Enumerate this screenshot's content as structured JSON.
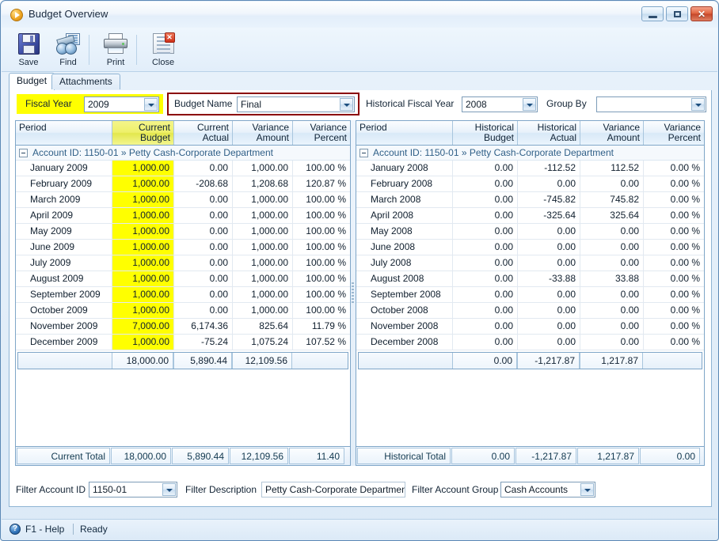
{
  "window": {
    "title": "Budget Overview",
    "icon": "play-circle-icon",
    "buttons": {
      "minimize": "minimize-button",
      "maximize": "maximize-button",
      "close": "✕"
    }
  },
  "toolbar": {
    "items": [
      {
        "label": "Save",
        "icon": "floppy-disk-icon"
      },
      {
        "label": "Find",
        "icon": "binoculars-icon"
      },
      {
        "label": "Print",
        "icon": "printer-icon"
      },
      {
        "label": "Close",
        "icon": "close-document-icon"
      }
    ]
  },
  "tabs": [
    {
      "label": "Budget",
      "active": true
    },
    {
      "label": "Attachments",
      "active": false
    }
  ],
  "criteria": {
    "fiscal_year_label": "Fiscal Year",
    "fiscal_year_value": "2009",
    "budget_name_label": "Budget Name",
    "budget_name_value": "Final",
    "historical_fiscal_year_label": "Historical Fiscal Year",
    "historical_fiscal_year_value": "2008",
    "group_by_label": "Group By",
    "group_by_value": "",
    "highlight_yellow": "#ffff00",
    "highlight_red_border": "#8b0000"
  },
  "left_grid": {
    "headers": [
      "Period",
      "Current\nBudget",
      "Current\nActual",
      "Variance\nAmount",
      "Variance\nPercent"
    ],
    "header_lines": [
      [
        "Period",
        ""
      ],
      [
        "Current",
        "Budget"
      ],
      [
        "Current",
        "Actual"
      ],
      [
        "Variance",
        "Amount"
      ],
      [
        "Variance",
        "Percent"
      ]
    ],
    "group_row": {
      "prefix": "Account ID: 1150-01",
      "separator": "»",
      "description": "Petty Cash-Corporate Department"
    },
    "rows": [
      {
        "period": "January 2009",
        "budget": "1,000.00",
        "actual": "0.00",
        "variance_amount": "1,000.00",
        "variance_percent": "100.00 %"
      },
      {
        "period": "February 2009",
        "budget": "1,000.00",
        "actual": "-208.68",
        "variance_amount": "1,208.68",
        "variance_percent": "120.87 %"
      },
      {
        "period": "March 2009",
        "budget": "1,000.00",
        "actual": "0.00",
        "variance_amount": "1,000.00",
        "variance_percent": "100.00 %"
      },
      {
        "period": "April 2009",
        "budget": "1,000.00",
        "actual": "0.00",
        "variance_amount": "1,000.00",
        "variance_percent": "100.00 %"
      },
      {
        "period": "May 2009",
        "budget": "1,000.00",
        "actual": "0.00",
        "variance_amount": "1,000.00",
        "variance_percent": "100.00 %"
      },
      {
        "period": "June 2009",
        "budget": "1,000.00",
        "actual": "0.00",
        "variance_amount": "1,000.00",
        "variance_percent": "100.00 %"
      },
      {
        "period": "July 2009",
        "budget": "1,000.00",
        "actual": "0.00",
        "variance_amount": "1,000.00",
        "variance_percent": "100.00 %"
      },
      {
        "period": "August 2009",
        "budget": "1,000.00",
        "actual": "0.00",
        "variance_amount": "1,000.00",
        "variance_percent": "100.00 %"
      },
      {
        "period": "September 2009",
        "budget": "1,000.00",
        "actual": "0.00",
        "variance_amount": "1,000.00",
        "variance_percent": "100.00 %"
      },
      {
        "period": "October 2009",
        "budget": "1,000.00",
        "actual": "0.00",
        "variance_amount": "1,000.00",
        "variance_percent": "100.00 %"
      },
      {
        "period": "November 2009",
        "budget": "7,000.00",
        "actual": "6,174.36",
        "variance_amount": "825.64",
        "variance_percent": "11.79 %"
      },
      {
        "period": "December 2009",
        "budget": "1,000.00",
        "actual": "-75.24",
        "variance_amount": "1,075.24",
        "variance_percent": "107.52 %"
      }
    ],
    "subtotal": {
      "budget": "18,000.00",
      "actual": "5,890.44",
      "variance_amount": "12,109.56",
      "variance_percent": ""
    },
    "total": {
      "label": "Current Total",
      "budget": "18,000.00",
      "actual": "5,890.44",
      "variance_amount": "12,109.56",
      "variance_percent": "11.40"
    }
  },
  "right_grid": {
    "header_lines": [
      [
        "Period",
        ""
      ],
      [
        "Historical",
        "Budget"
      ],
      [
        "Historical",
        "Actual"
      ],
      [
        "Variance",
        "Amount"
      ],
      [
        "Variance",
        "Percent"
      ]
    ],
    "group_row": {
      "prefix": "Account ID: 1150-01",
      "separator": "»",
      "description": "Petty Cash-Corporate Department"
    },
    "rows": [
      {
        "period": "January 2008",
        "budget": "0.00",
        "actual": "-112.52",
        "variance_amount": "112.52",
        "variance_percent": "0.00 %"
      },
      {
        "period": "February 2008",
        "budget": "0.00",
        "actual": "0.00",
        "variance_amount": "0.00",
        "variance_percent": "0.00 %"
      },
      {
        "period": "March 2008",
        "budget": "0.00",
        "actual": "-745.82",
        "variance_amount": "745.82",
        "variance_percent": "0.00 %"
      },
      {
        "period": "April 2008",
        "budget": "0.00",
        "actual": "-325.64",
        "variance_amount": "325.64",
        "variance_percent": "0.00 %"
      },
      {
        "period": "May 2008",
        "budget": "0.00",
        "actual": "0.00",
        "variance_amount": "0.00",
        "variance_percent": "0.00 %"
      },
      {
        "period": "June 2008",
        "budget": "0.00",
        "actual": "0.00",
        "variance_amount": "0.00",
        "variance_percent": "0.00 %"
      },
      {
        "period": "July 2008",
        "budget": "0.00",
        "actual": "0.00",
        "variance_amount": "0.00",
        "variance_percent": "0.00 %"
      },
      {
        "period": "August 2008",
        "budget": "0.00",
        "actual": "-33.88",
        "variance_amount": "33.88",
        "variance_percent": "0.00 %"
      },
      {
        "period": "September 2008",
        "budget": "0.00",
        "actual": "0.00",
        "variance_amount": "0.00",
        "variance_percent": "0.00 %"
      },
      {
        "period": "October 2008",
        "budget": "0.00",
        "actual": "0.00",
        "variance_amount": "0.00",
        "variance_percent": "0.00 %"
      },
      {
        "period": "November 2008",
        "budget": "0.00",
        "actual": "0.00",
        "variance_amount": "0.00",
        "variance_percent": "0.00 %"
      },
      {
        "period": "December 2008",
        "budget": "0.00",
        "actual": "0.00",
        "variance_amount": "0.00",
        "variance_percent": "0.00 %"
      }
    ],
    "subtotal": {
      "budget": "0.00",
      "actual": "-1,217.87",
      "variance_amount": "1,217.87",
      "variance_percent": ""
    },
    "total": {
      "label": "Historical Total",
      "budget": "0.00",
      "actual": "-1,217.87",
      "variance_amount": "1,217.87",
      "variance_percent": "0.00"
    }
  },
  "filters": {
    "account_id_label": "Filter Account ID",
    "account_id_value": "1150-01",
    "description_label": "Filter Description",
    "description_value": "Petty Cash-Corporate Department",
    "account_group_label": "Filter Account Group",
    "account_group_value": "Cash Accounts"
  },
  "statusbar": {
    "help_icon": "question-mark-icon",
    "help": "F1 - Help",
    "ready": "Ready"
  }
}
